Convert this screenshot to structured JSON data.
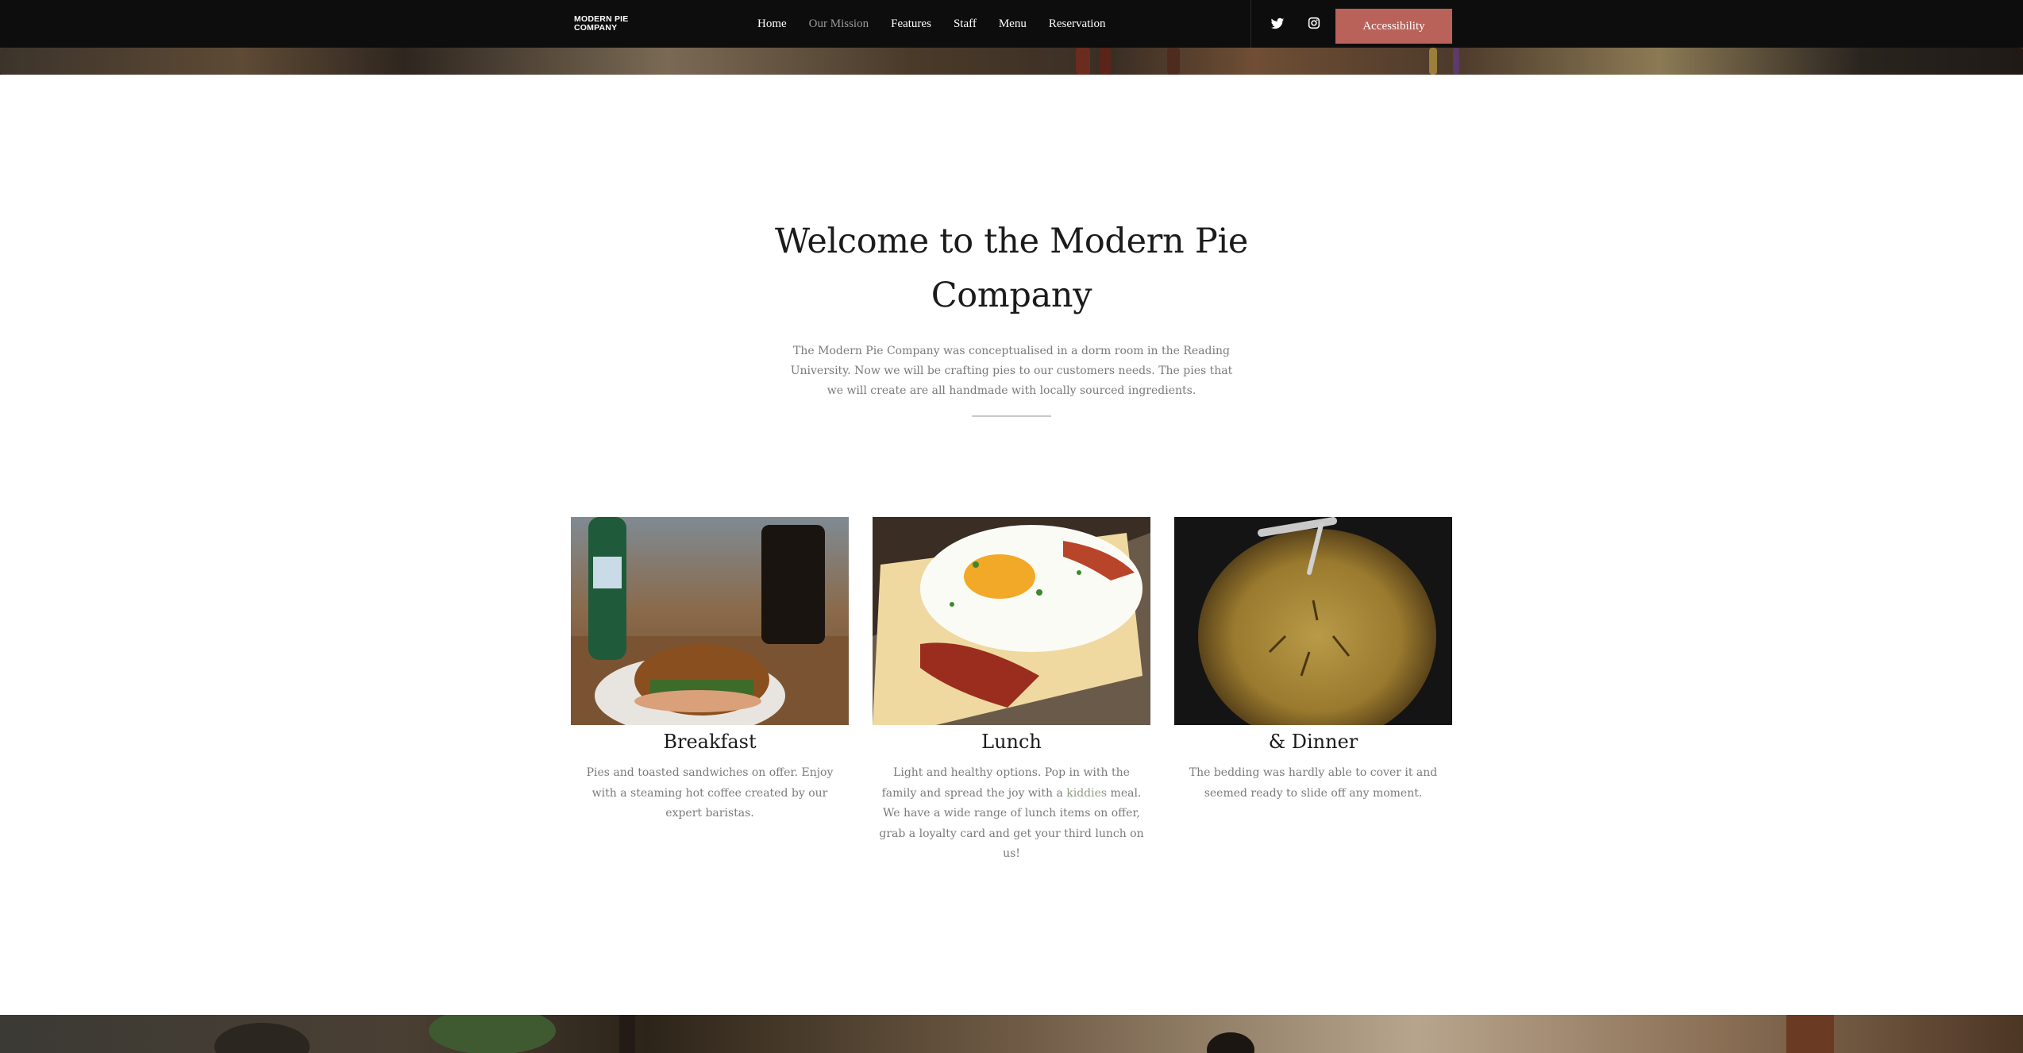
{
  "brand": {
    "line1": "MODERN PIE",
    "line2": "COMPANY"
  },
  "nav": {
    "items": [
      {
        "label": "Home",
        "active": false
      },
      {
        "label": "Our Mission",
        "active": true
      },
      {
        "label": "Features",
        "active": false
      },
      {
        "label": "Staff",
        "active": false
      },
      {
        "label": "Menu",
        "active": false
      },
      {
        "label": "Reservation",
        "active": false
      }
    ],
    "social": [
      "twitter-icon",
      "instagram-icon"
    ],
    "accessibility_label": "Accessibility"
  },
  "colors": {
    "nav_bg": "#0d0d0d",
    "accent": "#b9625a",
    "link": "#8c9a82",
    "muted_text": "#7a7a7a"
  },
  "welcome": {
    "title": "Welcome to the Modern Pie Company",
    "text": "The Modern Pie Company was conceptualised in a dorm room in the Reading University. Now we will be crafting pies to our customers needs. The pies that we will create are all handmade with locally sourced ingredients."
  },
  "cards": [
    {
      "title": "Breakfast",
      "text": "Pies and toasted sandwiches on offer. Enjoy with a steaming hot coffee created by our expert baristas."
    },
    {
      "title": "Lunch",
      "text_before": "Light and healthy options. Pop in with the family and spread the joy with a ",
      "link": "kiddies",
      "text_after": " meal. We have a wide range of lunch items on offer, grab a loyalty card and get your third lunch on us!"
    },
    {
      "title": "& Dinner",
      "text": "The bedding was hardly able to cover it and seemed ready to slide off any moment."
    }
  ]
}
